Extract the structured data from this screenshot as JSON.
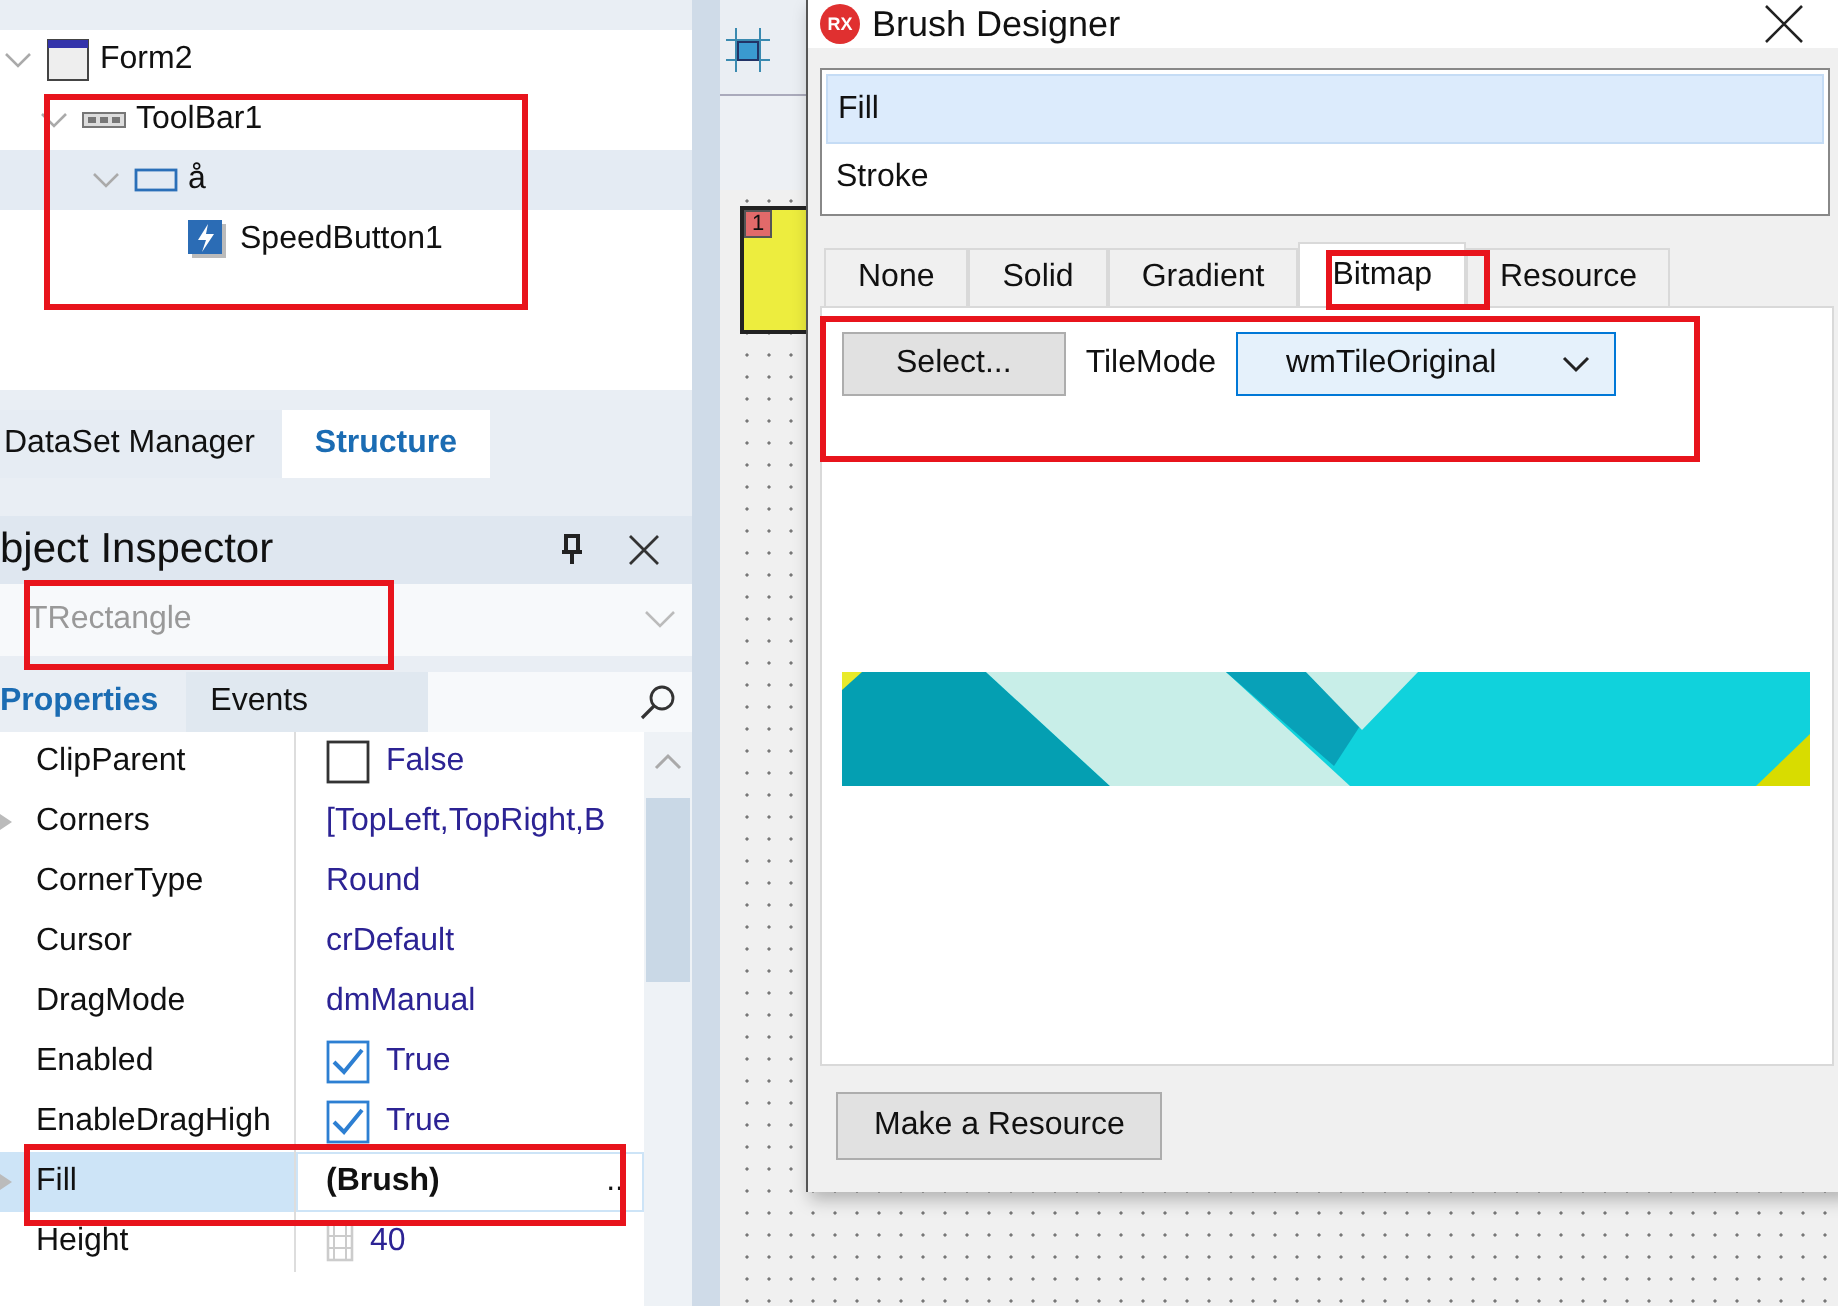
{
  "structure_tree": {
    "nodes": [
      {
        "label": "Form2",
        "kind": "form",
        "expanded": true,
        "selected": false,
        "children": [
          {
            "label": "ToolBar1",
            "kind": "toolbar",
            "expanded": true,
            "selected": false,
            "children": [
              {
                "label": "å",
                "kind": "rectangle",
                "expanded": true,
                "selected": true,
                "children": [
                  {
                    "label": "SpeedButton1",
                    "kind": "speedbutton",
                    "selected": false
                  }
                ]
              }
            ]
          }
        ]
      }
    ]
  },
  "panel_tabs": [
    {
      "label": "DataSet Manager",
      "selected": false
    },
    {
      "label": "Structure",
      "selected": true
    }
  ],
  "object_inspector": {
    "title": "bject Inspector",
    "object_combo": {
      "value": "TRectangle"
    },
    "tabs": [
      {
        "label": "Properties",
        "selected": true
      },
      {
        "label": "Events",
        "selected": false
      }
    ],
    "properties": [
      {
        "name": "ClipParent",
        "kind": "checkbox",
        "checked": false,
        "value": "False",
        "selected": false,
        "expandable": false
      },
      {
        "name": "Corners",
        "kind": "text",
        "value": "[TopLeft,TopRight,B",
        "selected": false,
        "expandable": true
      },
      {
        "name": "CornerType",
        "kind": "text",
        "value": "Round",
        "selected": false,
        "expandable": false
      },
      {
        "name": "Cursor",
        "kind": "text",
        "value": "crDefault",
        "selected": false,
        "expandable": false
      },
      {
        "name": "DragMode",
        "kind": "text",
        "value": "dmManual",
        "selected": false,
        "expandable": false
      },
      {
        "name": "Enabled",
        "kind": "checkbox",
        "checked": true,
        "value": "True",
        "selected": false,
        "expandable": false
      },
      {
        "name": "EnableDragHigh",
        "kind": "checkbox",
        "checked": true,
        "value": "True",
        "selected": false,
        "expandable": false
      },
      {
        "name": "Fill",
        "kind": "object",
        "value": "(Brush)",
        "button": "..",
        "selected": true,
        "expandable": true
      },
      {
        "name": "Height",
        "kind": "number",
        "value": "40",
        "selected": false,
        "expandable": false
      }
    ]
  },
  "designer": {
    "component_label": "1"
  },
  "brush_designer": {
    "title": "Brush Designer",
    "logo": "RX",
    "targets": [
      {
        "label": "Fill",
        "selected": true
      },
      {
        "label": "Stroke",
        "selected": false
      }
    ],
    "tabs": [
      {
        "label": "None",
        "selected": false
      },
      {
        "label": "Solid",
        "selected": false
      },
      {
        "label": "Gradient",
        "selected": false
      },
      {
        "label": "Bitmap",
        "selected": true
      },
      {
        "label": "Resource",
        "selected": false
      }
    ],
    "select_button": "Select...",
    "tile_mode_label": "TileMode",
    "tile_mode_value": "wmTileOriginal",
    "make_resource_button": "Make a Resource"
  }
}
